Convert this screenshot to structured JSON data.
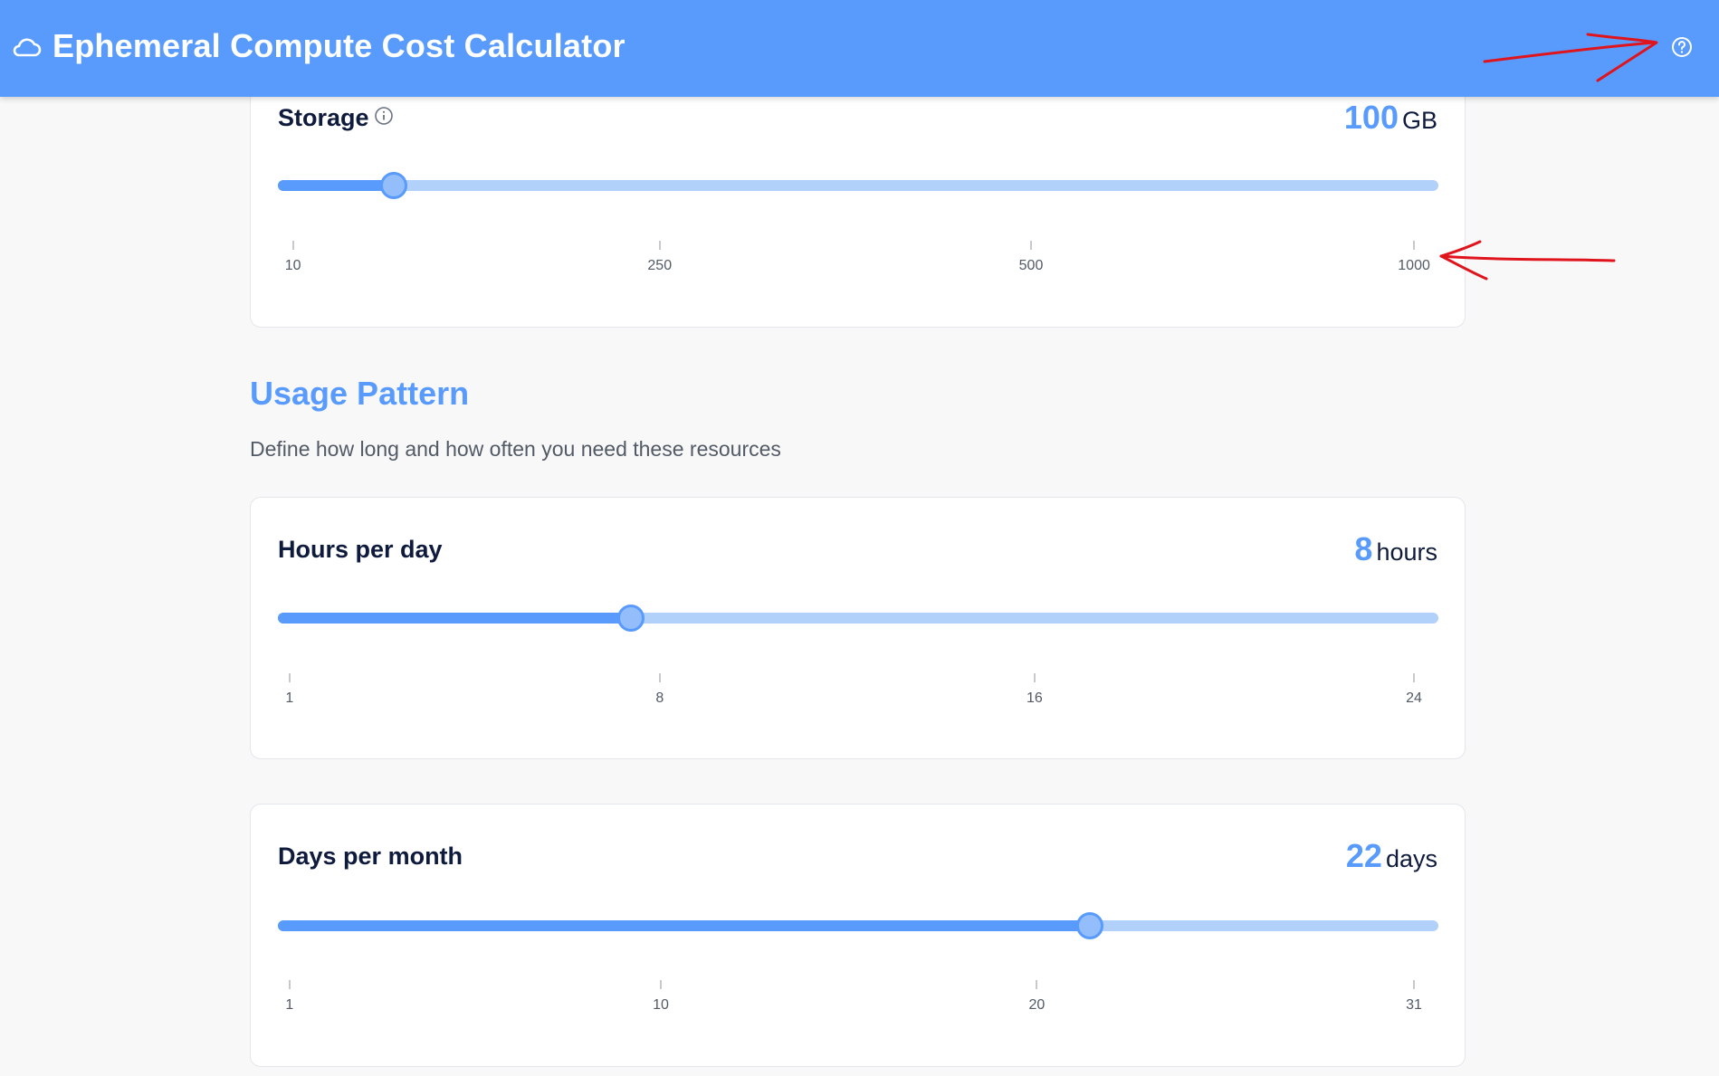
{
  "header": {
    "title": "Ephemeral Compute Cost Calculator",
    "logo_icon": "cloud-icon",
    "help_icon": "help-circle-icon",
    "background_color": "#589bfc"
  },
  "storage": {
    "label": "Storage",
    "info_icon": "info-icon",
    "value": "100",
    "unit": "GB",
    "slider_position": 0.1,
    "ticks": [
      "10",
      "250",
      "500",
      "1000"
    ]
  },
  "usage": {
    "title": "Usage Pattern",
    "description": "Define how long and how often you need these resources"
  },
  "hours": {
    "label": "Hours per day",
    "value": "8",
    "unit": "hours",
    "slider_position": 0.3043,
    "ticks": [
      "1",
      "8",
      "16",
      "24"
    ]
  },
  "days": {
    "label": "Days per month",
    "value": "22",
    "unit": "days",
    "slider_position": 0.7,
    "ticks": [
      "1",
      "10",
      "20",
      "31"
    ]
  },
  "colors": {
    "accent": "#589bfc",
    "track": "#b1d1fb",
    "annotation": "#e0141c"
  }
}
